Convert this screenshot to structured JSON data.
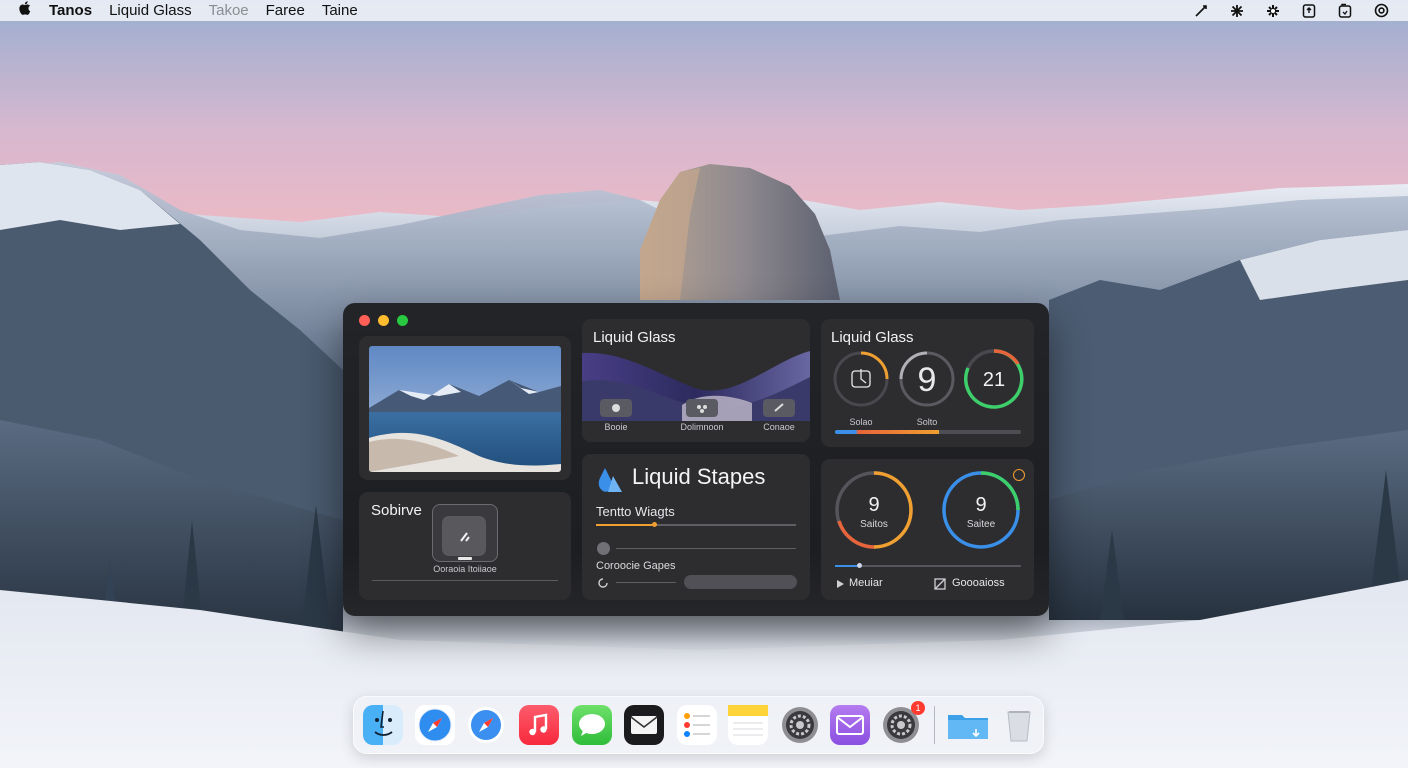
{
  "menubar": {
    "apple": "",
    "items": [
      "Tanos",
      "Liquid Glass",
      "Takoe",
      "Faree",
      "Taine"
    ],
    "status_icons": [
      "pen-icon",
      "asterisk-icon",
      "sparkle-icon",
      "share-icon",
      "folder-icon",
      "target-icon"
    ]
  },
  "window": {
    "photo_panel": {},
    "settings_panel": {
      "title": "Sobirve",
      "caption": "Ooraoia Itoiiaoe"
    },
    "wave_panel": {
      "title": "Liquid Glass",
      "buttons": [
        "Booie",
        "Dolimnoon",
        "Conaoe"
      ]
    },
    "shapes_panel": {
      "title": "Liquid Stapes",
      "subtitle": "Tentto Wiagts",
      "slider1": 0.5,
      "caption2": "Coroocie Gapes"
    },
    "rings_panel": {
      "title": "Liquid Glass",
      "rings": [
        {
          "value": "",
          "label": "Solao",
          "color": "#f0a030"
        },
        {
          "value": "9",
          "label": "Solto",
          "color": "#aaaaaa"
        },
        {
          "value": "21",
          "label": "",
          "color": "#3ccf6a"
        }
      ],
      "progress": 0.56
    },
    "timers_panel": {
      "rings": [
        {
          "value": "9",
          "label": "Saitos",
          "color": "#f0a030"
        },
        {
          "value": "9",
          "label": "Saitee",
          "color": "#3ccf6a"
        }
      ],
      "footer_left": "Meuiar",
      "footer_right": "Goooaioss"
    }
  },
  "dock": {
    "apps": [
      "finder-icon",
      "safari-icon",
      "safari-icon",
      "music-icon",
      "messages-icon",
      "mail-icon",
      "reminders-icon",
      "notes-icon",
      "settings-icon",
      "mail-alt-icon",
      "settings-icon",
      "folder-icon",
      "trash-icon"
    ],
    "badge": "1"
  },
  "colors": {
    "window_bg": "#1c1c1e",
    "panel_bg": "#2d2d30",
    "accent_blue": "#3a8fe8",
    "accent_orange": "#f0a030",
    "accent_green": "#3ccf6a"
  }
}
